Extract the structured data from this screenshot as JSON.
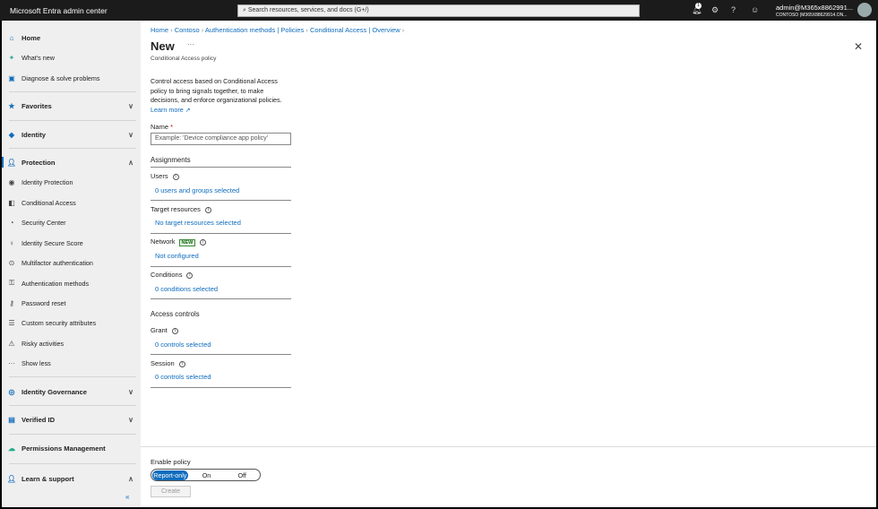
{
  "top": {
    "title": "Microsoft Entra admin center",
    "search_placeholder": "Search resources, services, and docs (G+/)",
    "notif_count": "1",
    "account": "admin@M365x8862991...",
    "tenant": "CONTOSO (M365X88629914.ON..."
  },
  "sidebar": {
    "top": [
      "Home",
      "What's new",
      "Diagnose & solve problems"
    ],
    "favorites": "Favorites",
    "identity": "Identity",
    "protection": "Protection",
    "protection_items": [
      "Identity Protection",
      "Conditional Access",
      "Security Center",
      "Identity Secure Score",
      "Multifactor authentication",
      "Authentication methods",
      "Password reset",
      "Custom security attributes",
      "Risky activities",
      "Show less"
    ],
    "governance": "Identity Governance",
    "verified": "Verified ID",
    "permissions": "Permissions Management",
    "learn": "Learn & support",
    "collapse": "«"
  },
  "breadcrumb": [
    "Home",
    "Contoso",
    "Authentication methods | Policies",
    "Conditional Access | Overview"
  ],
  "page": {
    "title": "New",
    "more": "···",
    "subtitle": "Conditional Access policy",
    "desc": [
      "Control access based on Conditional Access",
      "policy to bring signals together, to make",
      "decisions, and enforce organizational policies."
    ],
    "learn_more": "Learn more",
    "name_label": "Name",
    "required": "*",
    "name_placeholder": "Example: 'Device compliance app policy'"
  },
  "assignments": {
    "heading": "Assignments",
    "users": "Users",
    "users_val": "0 users and groups selected",
    "target": "Target resources",
    "target_val": "No target resources selected",
    "network": "Network",
    "network_badge": "NEW",
    "network_val": "Not configured",
    "conditions": "Conditions",
    "conditions_val": "0 conditions selected"
  },
  "access": {
    "heading": "Access controls",
    "grant": "Grant",
    "grant_val": "0 controls selected",
    "session": "Session",
    "session_val": "0 controls selected"
  },
  "footer": {
    "enable": "Enable policy",
    "options": [
      "Report-only",
      "On",
      "Off"
    ],
    "create": "Create"
  }
}
